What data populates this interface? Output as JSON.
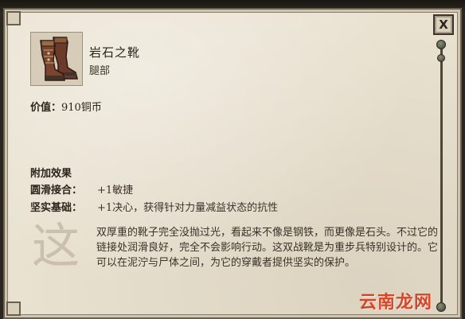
{
  "item": {
    "name": "岩石之靴",
    "slot": "腿部",
    "price_label": "价值：",
    "price_value": "910铜币"
  },
  "effects": {
    "title": "附加效果",
    "list": [
      {
        "name": "圆滑接合：",
        "value": "+1敏捷"
      },
      {
        "name": "坚实基础：",
        "value": "+1决心，获得针对力量减益状态的抗性"
      }
    ]
  },
  "description": {
    "drop_cap": "这",
    "text": "双厚重的靴子完全没抛过光，看起来不像是钢铁，而更像是石头。不过它的链接处润滑良好，完全不会影响行动。这双战靴是为重步兵特别设计的。它可以在泥泞与尸体之间，为它的穿戴者提供坚实的保护。"
  },
  "controls": {
    "close": "X"
  },
  "watermark": "云南龙网",
  "icons": {
    "item": "boots-icon",
    "close": "close-icon"
  }
}
